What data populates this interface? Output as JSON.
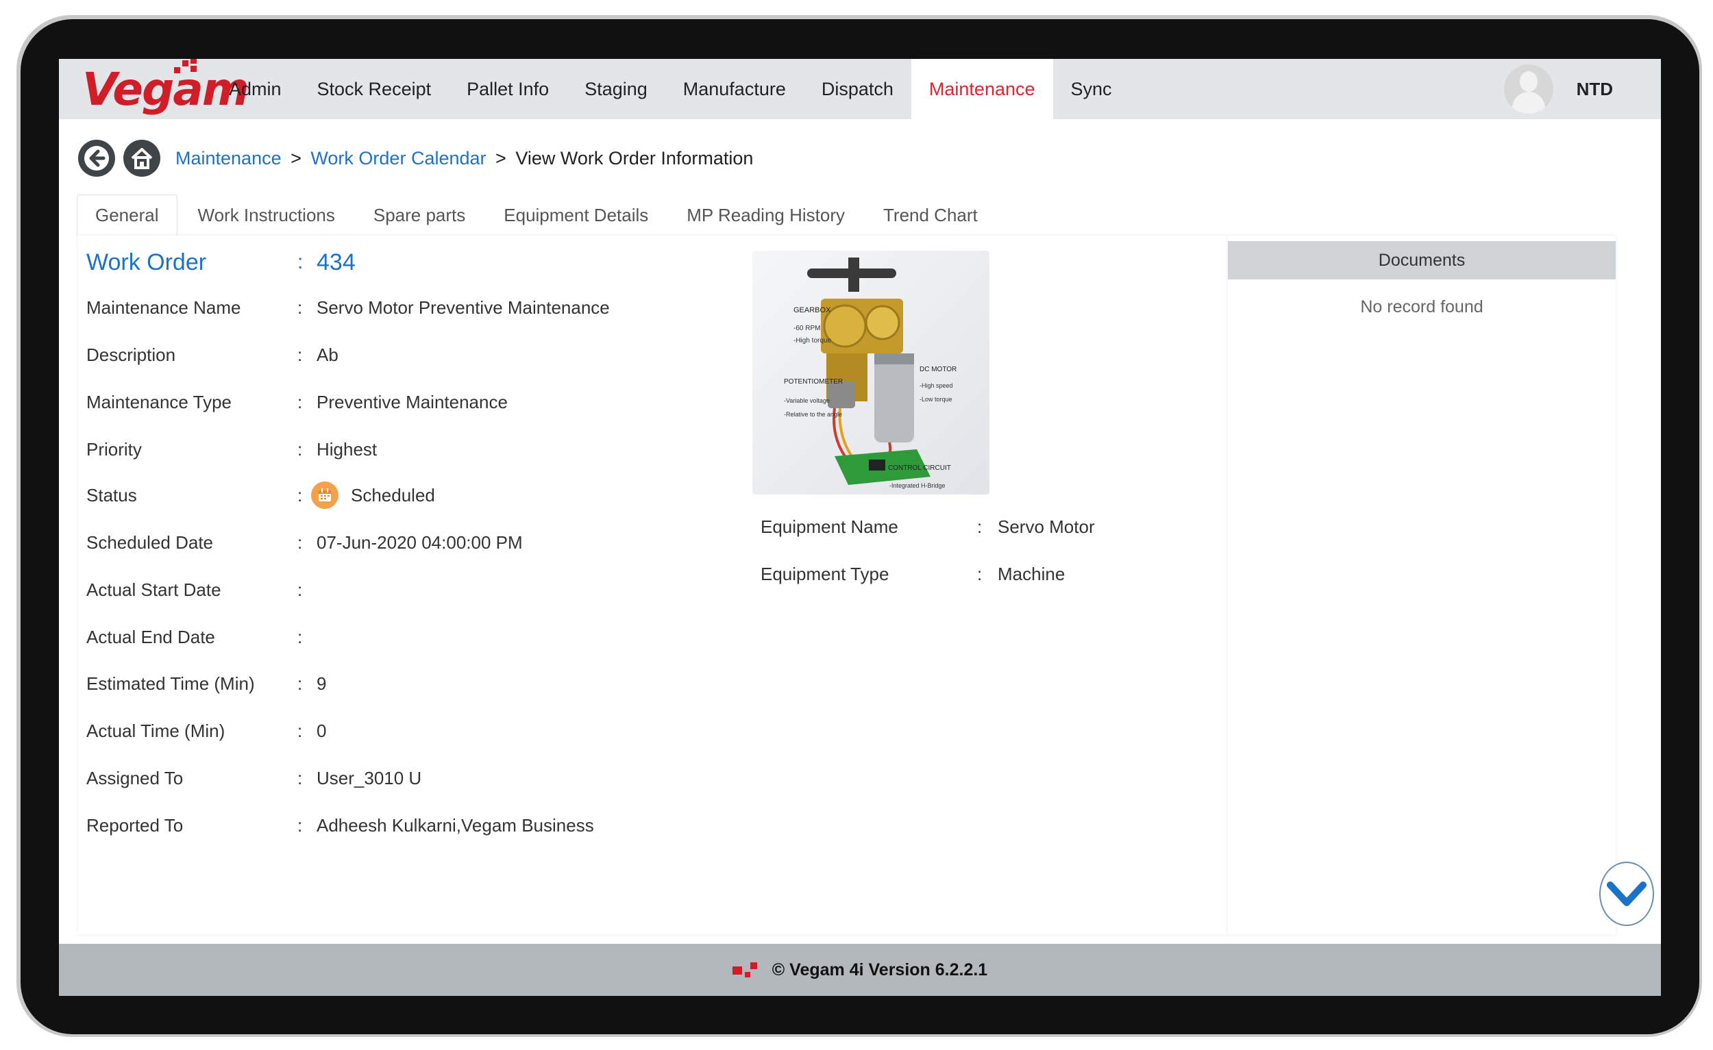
{
  "app": {
    "logo_text": "Vegam",
    "brand_color": "#d11d28",
    "link_color": "#1c72c7",
    "active_nav_color": "#e1232b"
  },
  "nav": {
    "items": [
      {
        "label": "Admin"
      },
      {
        "label": "Stock Receipt"
      },
      {
        "label": "Pallet Info"
      },
      {
        "label": "Staging"
      },
      {
        "label": "Manufacture"
      },
      {
        "label": "Dispatch"
      },
      {
        "label": "Maintenance",
        "active": true
      },
      {
        "label": "Sync"
      }
    ],
    "user_name": "NTD",
    "avatar_icon": "user-avatar-icon"
  },
  "breadcrumb": {
    "back_icon": "back-arrow-icon",
    "home_icon": "home-icon",
    "items": [
      "Maintenance",
      "Work Order Calendar"
    ],
    "separator": ">",
    "current": "View Work Order Information"
  },
  "tabs": [
    {
      "label": "General",
      "active": true
    },
    {
      "label": "Work Instructions"
    },
    {
      "label": "Spare parts"
    },
    {
      "label": "Equipment Details"
    },
    {
      "label": "MP Reading History"
    },
    {
      "label": "Trend Chart"
    }
  ],
  "work_order": {
    "title_label": "Work Order",
    "title_value": "434",
    "separator": ":",
    "fields": [
      {
        "label": "Maintenance Name",
        "value": "Servo Motor Preventive Maintenance"
      },
      {
        "label": "Description",
        "value": "Ab"
      },
      {
        "label": "Maintenance Type",
        "value": "Preventive Maintenance"
      },
      {
        "label": "Priority",
        "value": "Highest"
      },
      {
        "label": "Status",
        "value": "Scheduled",
        "icon": "calendar-icon"
      },
      {
        "label": "Scheduled Date",
        "value": "07-Jun-2020 04:00:00 PM"
      },
      {
        "label": "Actual Start Date",
        "value": ""
      },
      {
        "label": "Actual End Date",
        "value": ""
      },
      {
        "label": "Estimated Time (Min)",
        "value": "9"
      },
      {
        "label": "Actual Time (Min)",
        "value": "0"
      },
      {
        "label": "Assigned To",
        "value": "User_3010 U"
      },
      {
        "label": "Reported To",
        "value": "Adheesh Kulkarni,Vegam Business"
      }
    ]
  },
  "equipment": {
    "image_labels": [
      "GEARBOX",
      "-60 RPM",
      "-High torque",
      "POTENTIOMETER",
      "-Variable voltage",
      "-Relative to the angle",
      "DC MOTOR",
      "-High speed",
      "-Low torque",
      "CONTROL CIRCUIT",
      "-Integrated H-Bridge"
    ],
    "fields": [
      {
        "label": "Equipment Name",
        "value": "Servo Motor"
      },
      {
        "label": "Equipment Type",
        "value": "Machine"
      }
    ]
  },
  "documents": {
    "header": "Documents",
    "empty_text": "No record found"
  },
  "scroll_icon": "chevron-down-icon",
  "footer": {
    "text": "© Vegam 4i Version 6.2.2.1"
  }
}
